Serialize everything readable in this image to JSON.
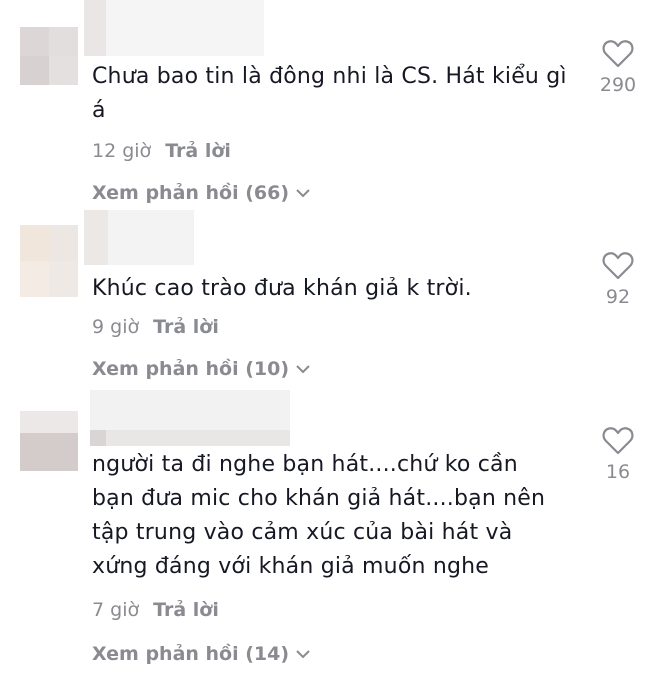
{
  "comments": [
    {
      "text": "Chưa bao tin là đông nhi là CS. Hát kiểu gì á",
      "time": "12 giờ",
      "reply_label": "Trả lời",
      "view_replies_label": "Xem phản hồi (66)",
      "likes": "290",
      "avatar_colors": [
        "#dcd7d6",
        "#e1dedd",
        "#d7d2d1",
        "#e4e0df"
      ]
    },
    {
      "text": "Khúc cao trào đưa khán giả k trời.",
      "time": "9 giờ",
      "reply_label": "Trả lời",
      "view_replies_label": "Xem phản hồi (10)",
      "likes": "92",
      "avatar_colors": [
        "#f0e6dc",
        "#ece7e3",
        "#f3ebe4",
        "#efe9e5"
      ]
    },
    {
      "text": "người ta đi nghe bạn hát....chứ ko cần bạn đưa mic cho khán giả hát....bạn nên tập trung vào cảm xúc của bài hát và xứng đáng với khán giả muốn nghe",
      "time": "7 giờ",
      "reply_label": "Trả lời",
      "view_replies_label": "Xem phản hồi (14)",
      "likes": "16",
      "avatar_colors": [
        "#e6e2e1",
        "#ebe8e7",
        "#cfc8c6",
        "#d8d2d0"
      ]
    }
  ],
  "icons": {
    "like": "heart-outline-icon",
    "expand": "chevron-down-icon"
  },
  "colors": {
    "text": "#161823",
    "muted": "#8a8b91"
  }
}
